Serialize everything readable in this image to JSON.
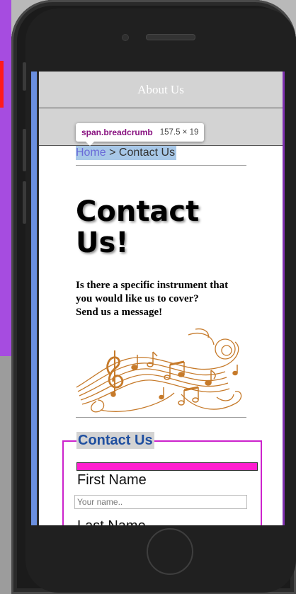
{
  "nav": {
    "about_label": "About Us"
  },
  "devtools_tooltip": {
    "selector": "span.breadcrumb",
    "dimensions": "157.5 × 19"
  },
  "breadcrumb": {
    "home": "Home",
    "separator": " > ",
    "current": "Contact Us"
  },
  "page": {
    "title": "Contact Us!",
    "intro_line1": "Is there a specific instrument that",
    "intro_line2": "you would like us to cover?",
    "intro_line3": "Send us a message!"
  },
  "form": {
    "legend": "Contact Us",
    "first_name_label": "First Name",
    "first_name_placeholder": "Your name..",
    "last_name_label": "Last Name"
  },
  "icons": {
    "camera": "camera-icon",
    "speaker": "speaker-icon",
    "home_button": "home-button-icon",
    "music_art": "music-notes-icon"
  },
  "colors": {
    "nav_bg": "#d3d3d3",
    "accent_blue": "#1f4fa0",
    "fieldset_border": "#cc22cc",
    "highlight_bar": "#ff1ecf"
  }
}
